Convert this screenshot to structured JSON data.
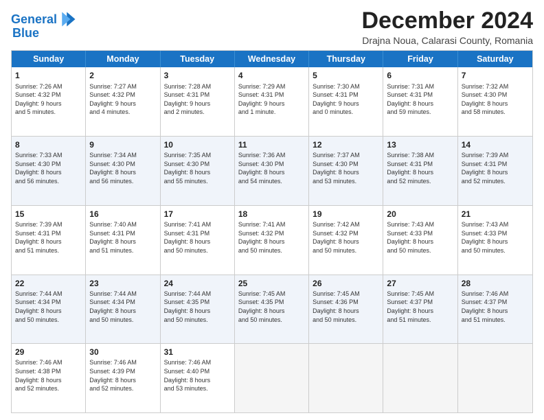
{
  "header": {
    "logo_line1": "General",
    "logo_line2": "Blue",
    "month": "December 2024",
    "location": "Drajna Noua, Calarasi County, Romania"
  },
  "days_of_week": [
    "Sunday",
    "Monday",
    "Tuesday",
    "Wednesday",
    "Thursday",
    "Friday",
    "Saturday"
  ],
  "weeks": [
    [
      {
        "day": "1",
        "text": "Sunrise: 7:26 AM\nSunset: 4:32 PM\nDaylight: 9 hours\nand 5 minutes.",
        "bg": "white"
      },
      {
        "day": "2",
        "text": "Sunrise: 7:27 AM\nSunset: 4:32 PM\nDaylight: 9 hours\nand 4 minutes.",
        "bg": "white"
      },
      {
        "day": "3",
        "text": "Sunrise: 7:28 AM\nSunset: 4:31 PM\nDaylight: 9 hours\nand 2 minutes.",
        "bg": "white"
      },
      {
        "day": "4",
        "text": "Sunrise: 7:29 AM\nSunset: 4:31 PM\nDaylight: 9 hours\nand 1 minute.",
        "bg": "white"
      },
      {
        "day": "5",
        "text": "Sunrise: 7:30 AM\nSunset: 4:31 PM\nDaylight: 9 hours\nand 0 minutes.",
        "bg": "white"
      },
      {
        "day": "6",
        "text": "Sunrise: 7:31 AM\nSunset: 4:31 PM\nDaylight: 8 hours\nand 59 minutes.",
        "bg": "white"
      },
      {
        "day": "7",
        "text": "Sunrise: 7:32 AM\nSunset: 4:30 PM\nDaylight: 8 hours\nand 58 minutes.",
        "bg": "white"
      }
    ],
    [
      {
        "day": "8",
        "text": "Sunrise: 7:33 AM\nSunset: 4:30 PM\nDaylight: 8 hours\nand 56 minutes.",
        "bg": "alt"
      },
      {
        "day": "9",
        "text": "Sunrise: 7:34 AM\nSunset: 4:30 PM\nDaylight: 8 hours\nand 56 minutes.",
        "bg": "alt"
      },
      {
        "day": "10",
        "text": "Sunrise: 7:35 AM\nSunset: 4:30 PM\nDaylight: 8 hours\nand 55 minutes.",
        "bg": "alt"
      },
      {
        "day": "11",
        "text": "Sunrise: 7:36 AM\nSunset: 4:30 PM\nDaylight: 8 hours\nand 54 minutes.",
        "bg": "alt"
      },
      {
        "day": "12",
        "text": "Sunrise: 7:37 AM\nSunset: 4:30 PM\nDaylight: 8 hours\nand 53 minutes.",
        "bg": "alt"
      },
      {
        "day": "13",
        "text": "Sunrise: 7:38 AM\nSunset: 4:31 PM\nDaylight: 8 hours\nand 52 minutes.",
        "bg": "alt"
      },
      {
        "day": "14",
        "text": "Sunrise: 7:39 AM\nSunset: 4:31 PM\nDaylight: 8 hours\nand 52 minutes.",
        "bg": "alt"
      }
    ],
    [
      {
        "day": "15",
        "text": "Sunrise: 7:39 AM\nSunset: 4:31 PM\nDaylight: 8 hours\nand 51 minutes.",
        "bg": "white"
      },
      {
        "day": "16",
        "text": "Sunrise: 7:40 AM\nSunset: 4:31 PM\nDaylight: 8 hours\nand 51 minutes.",
        "bg": "white"
      },
      {
        "day": "17",
        "text": "Sunrise: 7:41 AM\nSunset: 4:31 PM\nDaylight: 8 hours\nand 50 minutes.",
        "bg": "white"
      },
      {
        "day": "18",
        "text": "Sunrise: 7:41 AM\nSunset: 4:32 PM\nDaylight: 8 hours\nand 50 minutes.",
        "bg": "white"
      },
      {
        "day": "19",
        "text": "Sunrise: 7:42 AM\nSunset: 4:32 PM\nDaylight: 8 hours\nand 50 minutes.",
        "bg": "white"
      },
      {
        "day": "20",
        "text": "Sunrise: 7:43 AM\nSunset: 4:33 PM\nDaylight: 8 hours\nand 50 minutes.",
        "bg": "white"
      },
      {
        "day": "21",
        "text": "Sunrise: 7:43 AM\nSunset: 4:33 PM\nDaylight: 8 hours\nand 50 minutes.",
        "bg": "white"
      }
    ],
    [
      {
        "day": "22",
        "text": "Sunrise: 7:44 AM\nSunset: 4:34 PM\nDaylight: 8 hours\nand 50 minutes.",
        "bg": "alt"
      },
      {
        "day": "23",
        "text": "Sunrise: 7:44 AM\nSunset: 4:34 PM\nDaylight: 8 hours\nand 50 minutes.",
        "bg": "alt"
      },
      {
        "day": "24",
        "text": "Sunrise: 7:44 AM\nSunset: 4:35 PM\nDaylight: 8 hours\nand 50 minutes.",
        "bg": "alt"
      },
      {
        "day": "25",
        "text": "Sunrise: 7:45 AM\nSunset: 4:35 PM\nDaylight: 8 hours\nand 50 minutes.",
        "bg": "alt"
      },
      {
        "day": "26",
        "text": "Sunrise: 7:45 AM\nSunset: 4:36 PM\nDaylight: 8 hours\nand 50 minutes.",
        "bg": "alt"
      },
      {
        "day": "27",
        "text": "Sunrise: 7:45 AM\nSunset: 4:37 PM\nDaylight: 8 hours\nand 51 minutes.",
        "bg": "alt"
      },
      {
        "day": "28",
        "text": "Sunrise: 7:46 AM\nSunset: 4:37 PM\nDaylight: 8 hours\nand 51 minutes.",
        "bg": "alt"
      }
    ],
    [
      {
        "day": "29",
        "text": "Sunrise: 7:46 AM\nSunset: 4:38 PM\nDaylight: 8 hours\nand 52 minutes.",
        "bg": "white"
      },
      {
        "day": "30",
        "text": "Sunrise: 7:46 AM\nSunset: 4:39 PM\nDaylight: 8 hours\nand 52 minutes.",
        "bg": "white"
      },
      {
        "day": "31",
        "text": "Sunrise: 7:46 AM\nSunset: 4:40 PM\nDaylight: 8 hours\nand 53 minutes.",
        "bg": "white"
      },
      {
        "day": "",
        "text": "",
        "bg": "empty"
      },
      {
        "day": "",
        "text": "",
        "bg": "empty"
      },
      {
        "day": "",
        "text": "",
        "bg": "empty"
      },
      {
        "day": "",
        "text": "",
        "bg": "empty"
      }
    ]
  ]
}
